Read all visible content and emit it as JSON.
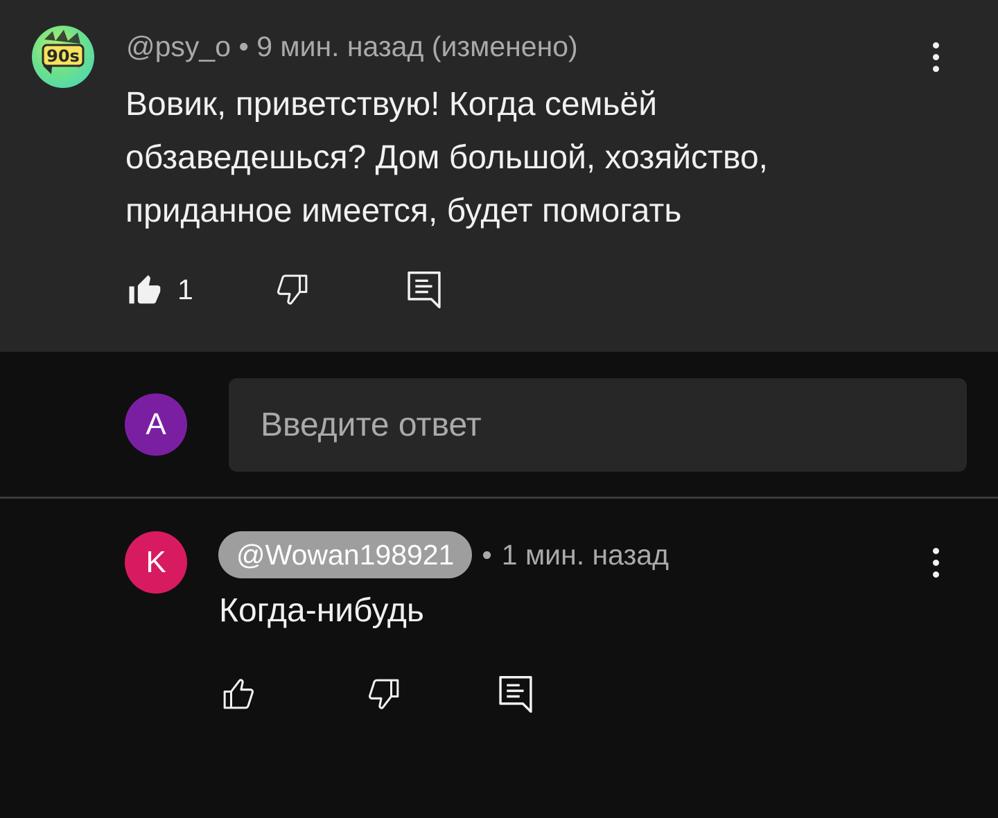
{
  "parent_comment": {
    "author": "@psy_o",
    "time": "9 мин. назад",
    "edited_label": "(изменено)",
    "text": "Вовик, приветствую! Когда семьёй обзаведешься? Дом большой, хозяйство, приданное имеется, будет помогать",
    "like_count": "1",
    "avatar_icon": "90s-retro-logo-icon",
    "like_icon": "thumb-up-filled-icon",
    "dislike_icon": "thumb-down-outline-icon",
    "reply_icon": "reply-comment-icon",
    "menu_icon": "more-vertical-icon"
  },
  "reply_box": {
    "avatar_letter": "A",
    "avatar_color": "#7b1fa2",
    "placeholder": "Введите ответ"
  },
  "reply_comment": {
    "avatar_letter": "K",
    "avatar_color": "#d81b60",
    "author": "@Wowan198921",
    "time": "1 мин. назад",
    "text": "Когда-нибудь",
    "like_icon": "thumb-up-outline-icon",
    "dislike_icon": "thumb-down-outline-icon",
    "reply_icon": "reply-comment-icon",
    "menu_icon": "more-vertical-icon"
  },
  "colors": {
    "page_background": "#0f0f0f",
    "highlighted_comment_background": "#272727",
    "primary_text": "#f1f1f1",
    "secondary_text": "#aaaaaa",
    "handle_chip": "#9e9e9e"
  }
}
